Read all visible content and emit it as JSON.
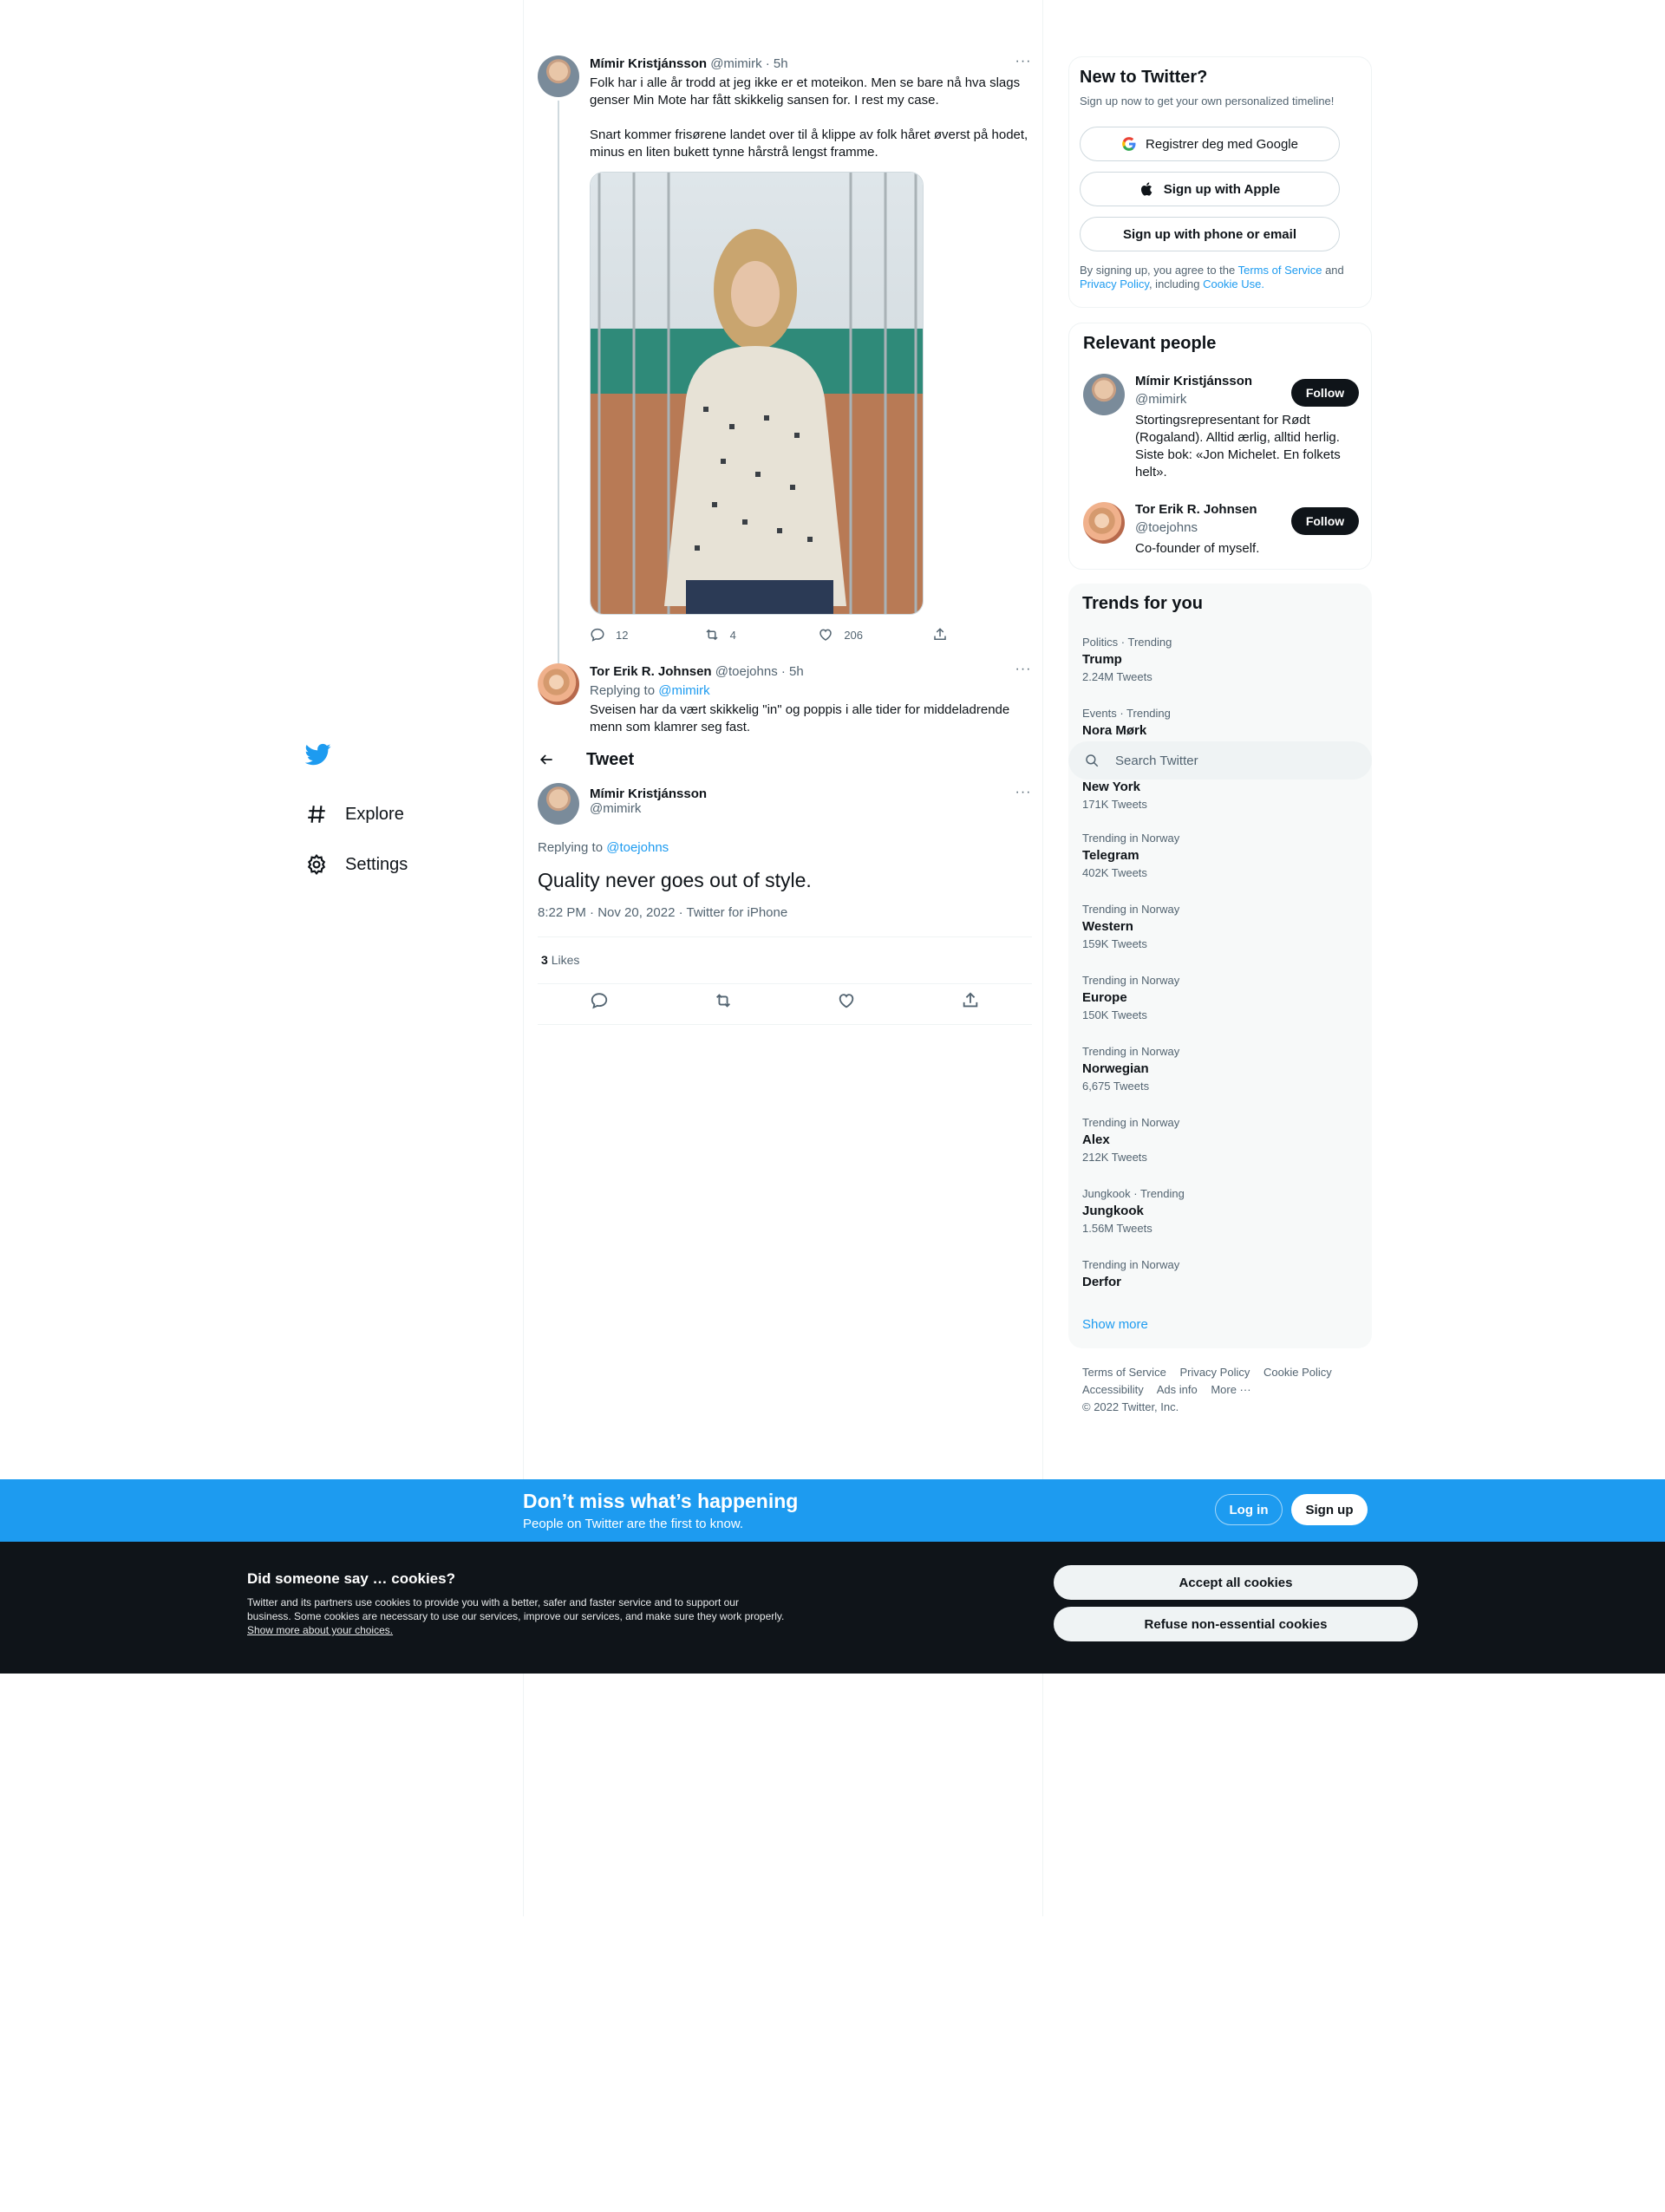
{
  "nav": {
    "logo": "twitter-bird-icon",
    "items": [
      {
        "label": "Explore",
        "icon": "hashtag-icon"
      },
      {
        "label": "Settings",
        "icon": "gear-icon"
      }
    ]
  },
  "thread": {
    "tweet1": {
      "name": "Mímir Kristjánsson",
      "handle": "@mimirk",
      "time": "· 5h",
      "text1": "Folk har i alle år trodd at jeg ikke er et moteikon. Men se bare nå hva slags genser Min Mote har fått skikkelig sansen for. I rest my case.",
      "text2": "Snart kommer frisørene landet over til å klippe av folk håret øverst på hodet, minus en liten bukett tynne hårstrå lengst framme.",
      "replies": "12",
      "retweets": "4",
      "likes": "206"
    },
    "tweet2": {
      "name": "Tor Erik R. Johnsen",
      "handle": "@toejohns",
      "time": "· 5h",
      "replying_label": "Replying to",
      "replying_to": "@mimirk",
      "text": "Sveisen har da vært skikkelig \"in\" og poppis i alle tider for middeladrende menn som klamrer seg fast."
    }
  },
  "header": {
    "title": "Tweet",
    "back_icon": "back-arrow-icon"
  },
  "main_tweet": {
    "name": "Mímir Kristjánsson",
    "handle": "@mimirk",
    "replying_label": "Replying to",
    "replying_to": "@toejohns",
    "text": "Quality never goes out of style.",
    "date": "8:22 PM · Nov 20, 2022 · Twitter for iPhone",
    "likes_count": "3",
    "likes_label": "Likes"
  },
  "signup_card": {
    "title": "New to Twitter?",
    "subtitle": "Sign up now to get your own personalized timeline!",
    "google_label": "Registrer deg med Google",
    "apple_label": "Sign up with Apple",
    "phone_label": "Sign up with phone or email",
    "legal_prefix": "By signing up, you agree to the",
    "terms": "Terms of Service",
    "and": "and",
    "privacy": "Privacy Policy",
    "including": ", including",
    "cookie": "Cookie Use."
  },
  "people_card": {
    "title": "Relevant people",
    "follow_label": "Follow",
    "people": [
      {
        "name": "Mímir Kristjánsson",
        "handle": "@mimirk",
        "bio": "Stortingsrepresentant for Rødt (Rogaland). Alltid ærlig, alltid herlig. Siste bok: «Jon Michelet. En folkets helt»."
      },
      {
        "name": "Tor Erik R. Johnsen",
        "handle": "@toejohns",
        "bio": "Co-founder of myself."
      }
    ]
  },
  "trends_card": {
    "title": "Trends for you",
    "items": [
      {
        "context": "Politics · Trending",
        "name": "Trump",
        "count": "2.24M Tweets"
      },
      {
        "context": "Events · Trending",
        "name": "Nora Mørk",
        "count": ""
      },
      {
        "context": "",
        "name": "New York",
        "count": "171K Tweets"
      },
      {
        "context": "Trending in Norway",
        "name": "Telegram",
        "count": "402K Tweets"
      },
      {
        "context": "Trending in Norway",
        "name": "Western",
        "count": "159K Tweets"
      },
      {
        "context": "Trending in Norway",
        "name": "Europe",
        "count": "150K Tweets"
      },
      {
        "context": "Trending in Norway",
        "name": "Norwegian",
        "count": "6,675 Tweets"
      },
      {
        "context": "Trending in Norway",
        "name": "Alex",
        "count": "212K Tweets"
      },
      {
        "context": "Jungkook · Trending",
        "name": "Jungkook",
        "count": "1.56M Tweets"
      },
      {
        "context": "Trending in Norway",
        "name": "Derfor",
        "count": ""
      }
    ],
    "show_more": "Show more"
  },
  "search": {
    "placeholder": "Search Twitter"
  },
  "footer": {
    "links": [
      "Terms of Service",
      "Privacy Policy",
      "Cookie Policy",
      "Accessibility",
      "Ads info",
      "More ···"
    ],
    "copyright": "© 2022 Twitter, Inc."
  },
  "banner": {
    "headline": "Don’t miss what’s happening",
    "sub": "People on Twitter are the first to know.",
    "login": "Log in",
    "signup": "Sign up"
  },
  "cookies": {
    "title": "Did someone say … cookies?",
    "text": "Twitter and its partners use cookies to provide you with a better, safer and faster service and to support our business. Some cookies are necessary to use our services, improve our services, and make sure they work properly.",
    "link": "Show more about your choices.",
    "accept": "Accept all cookies",
    "refuse": "Refuse non-essential cookies"
  },
  "colors": {
    "accent": "#1d9bf0",
    "text": "#0f1419",
    "muted": "#536471",
    "cookie_bg": "#0f1419"
  }
}
